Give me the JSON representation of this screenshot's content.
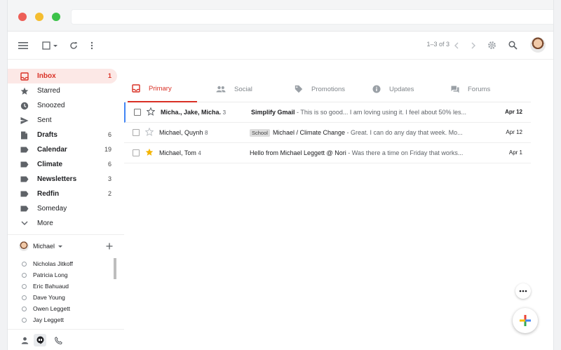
{
  "toolbar": {
    "pager": "1–3 of 3"
  },
  "sidebar": {
    "items": [
      {
        "label": "Inbox",
        "count": "1"
      },
      {
        "label": "Starred",
        "count": ""
      },
      {
        "label": "Snoozed",
        "count": ""
      },
      {
        "label": "Sent",
        "count": ""
      },
      {
        "label": "Drafts",
        "count": "6"
      },
      {
        "label": "Calendar",
        "count": "19"
      },
      {
        "label": "Climate",
        "count": "6"
      },
      {
        "label": "Newsletters",
        "count": "3"
      },
      {
        "label": "Redfin",
        "count": "2"
      },
      {
        "label": "Someday",
        "count": ""
      },
      {
        "label": "More",
        "count": ""
      }
    ]
  },
  "hangouts": {
    "user": "Michael",
    "contacts": [
      "Nicholas Jitkoff",
      "Patricia Long",
      "Eric Bahuaud",
      "Dave Young",
      "Owen Leggett",
      "Jay Leggett"
    ]
  },
  "tabs": [
    {
      "label": "Primary"
    },
    {
      "label": "Social"
    },
    {
      "label": "Promotions"
    },
    {
      "label": "Updates"
    },
    {
      "label": "Forums"
    }
  ],
  "emails": [
    {
      "sender": "Micha., Jake, Micha.",
      "count": "3",
      "label": "",
      "subject": "Simplify Gmail",
      "snippet": " - This is so good... I am loving using it. I feel about 50% les...",
      "date": "Apr 12"
    },
    {
      "sender": "Michael, Quynh",
      "count": "8",
      "label": "School",
      "subject": "Michael / Climate Change",
      "snippet": " - Great. I can do any day that week. Mo...",
      "date": "Apr 12"
    },
    {
      "sender": "Michael, Tom",
      "count": "4",
      "label": "",
      "subject": "Hello from Michael Leggett @ Nori",
      "snippet": " - Was there a time on Friday that works...",
      "date": "Apr 1"
    }
  ],
  "colors": {
    "accent": "#d93025",
    "accent_bg": "#fce8e6",
    "star_yellow": "#f4b400",
    "selected_border": "#4285f4"
  }
}
